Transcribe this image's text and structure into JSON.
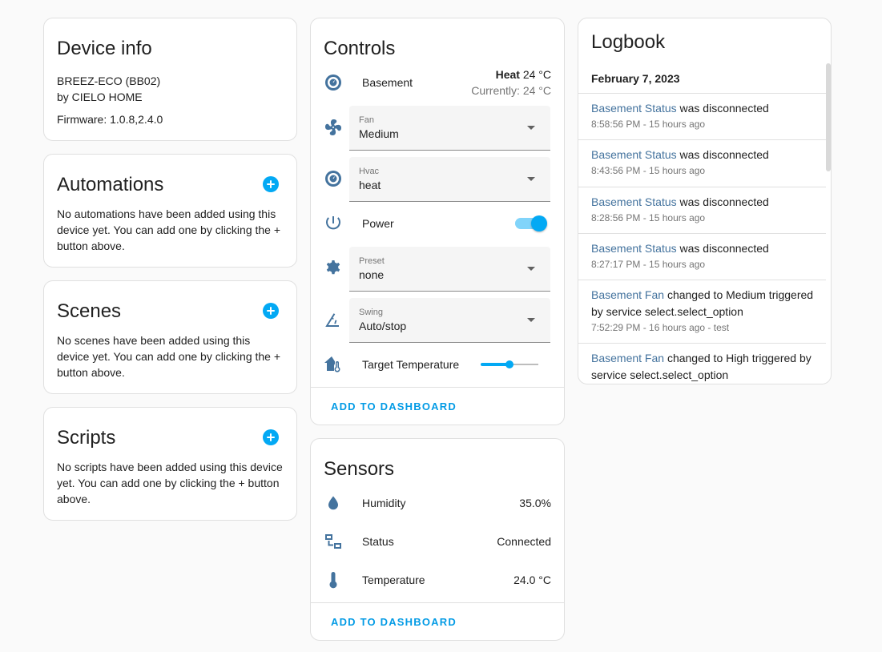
{
  "device_info": {
    "title": "Device info",
    "model": "BREEZ-ECO (BB02)",
    "manufacturer": "by CIELO HOME",
    "firmware": "Firmware: 1.0.8,2.4.0"
  },
  "automations": {
    "title": "Automations",
    "text": "No automations have been added using this device yet. You can add one by clicking the + button above."
  },
  "scenes": {
    "title": "Scenes",
    "text": "No scenes have been added using this device yet. You can add one by clicking the + button above."
  },
  "scripts": {
    "title": "Scripts",
    "text": "No scripts have been added using this device yet. You can add one by clicking the + button above."
  },
  "controls": {
    "title": "Controls",
    "climate": {
      "label": "Basement",
      "mode": "Heat",
      "target": "24 °C",
      "current": "Currently: 24 °C"
    },
    "fan": {
      "label": "Fan",
      "value": "Medium"
    },
    "hvac": {
      "label": "Hvac",
      "value": "heat"
    },
    "power": {
      "label": "Power",
      "on": true
    },
    "preset": {
      "label": "Preset",
      "value": "none"
    },
    "swing": {
      "label": "Swing",
      "value": "Auto/stop"
    },
    "target_temperature": {
      "label": "Target Temperature",
      "level": 0.5
    },
    "add_to_dashboard": "ADD TO DASHBOARD"
  },
  "sensors": {
    "title": "Sensors",
    "items": [
      {
        "label": "Humidity",
        "value": "35.0%",
        "icon": "water-drop-icon"
      },
      {
        "label": "Status",
        "value": "Connected",
        "icon": "network-icon"
      },
      {
        "label": "Temperature",
        "value": "24.0 °C",
        "icon": "thermometer-icon"
      }
    ],
    "add_to_dashboard": "ADD TO DASHBOARD"
  },
  "logbook": {
    "title": "Logbook",
    "date": "February 7, 2023",
    "entries": [
      {
        "entity": "Basement Status",
        "message": " was disconnected",
        "time": "8:58:56 PM - 15 hours ago"
      },
      {
        "entity": "Basement Status",
        "message": " was disconnected",
        "time": "8:43:56 PM - 15 hours ago"
      },
      {
        "entity": "Basement Status",
        "message": " was disconnected",
        "time": "8:28:56 PM - 15 hours ago"
      },
      {
        "entity": "Basement Status",
        "message": " was disconnected",
        "time": "8:27:17 PM - 15 hours ago"
      },
      {
        "entity": "Basement Fan",
        "message": " changed to Medium triggered by service select.select_option",
        "time": "7:52:29 PM - 16 hours ago - test"
      },
      {
        "entity": "Basement Fan",
        "message": " changed to High triggered by service select.select_option",
        "time": ""
      }
    ]
  },
  "colors": {
    "accent": "#03a9f4",
    "icon": "#44739e",
    "link": "#44739e",
    "button_text": "#039be5"
  }
}
